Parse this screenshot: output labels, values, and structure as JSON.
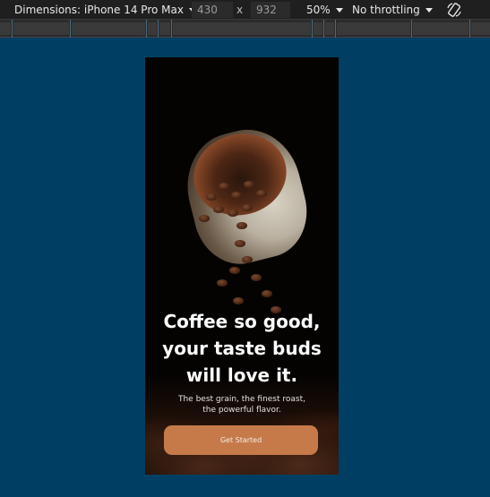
{
  "toolbar": {
    "dimensions_label": "Dimensions: iPhone 14 Pro Max",
    "width_value": "430",
    "times_sign": "x",
    "height_value": "932",
    "zoom_label": "50%",
    "throttling_label": "No throttling",
    "icons": {
      "dropdown": "chevron-down-icon",
      "rotate": "rotate-icon"
    },
    "colors": {
      "background": "#1f1f1f",
      "text": "#e8e8e8"
    }
  },
  "ruler": {
    "colors": {
      "background": "#2b2b2b",
      "segment": "#3a3a3a",
      "tick": "#4c6b80"
    }
  },
  "workspace": {
    "background": "#003f63"
  },
  "app": {
    "headline": "Coffee so good,\nyour taste buds\nwill love it.",
    "subline": "The best grain, the finest roast, the powerful flavor.",
    "cta_label": "Get Started",
    "colors": {
      "background": "#050302",
      "cta": "#c67a4a",
      "headline": "#ffffff"
    }
  }
}
